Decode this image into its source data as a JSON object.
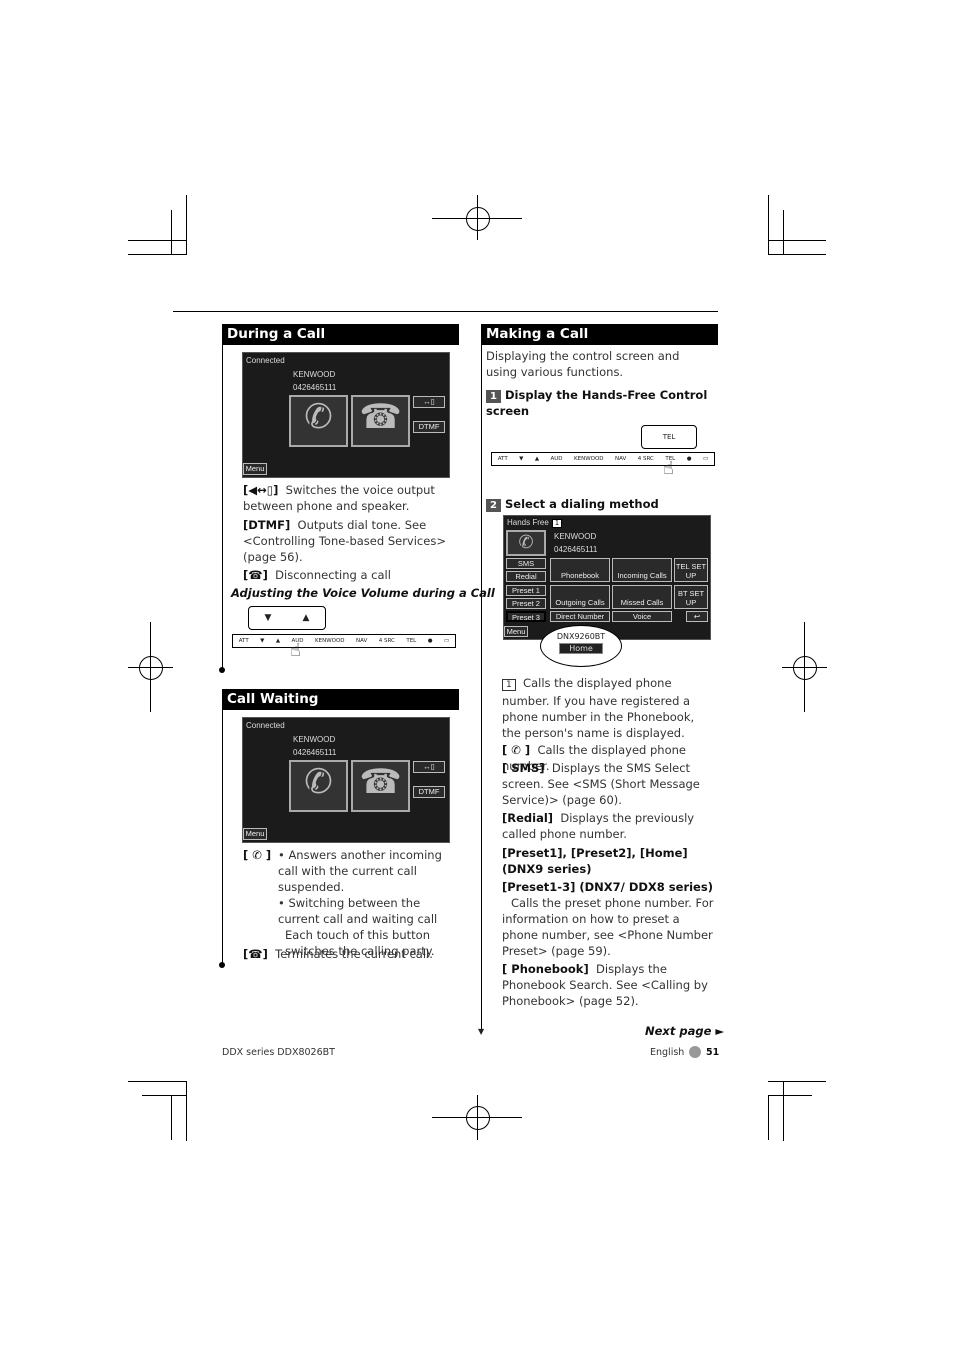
{
  "during_call": {
    "title": "During a Call",
    "screen": {
      "status": "Connected",
      "name": "KENWOOD",
      "number": "0426465111",
      "dtmf": "DTMF",
      "menu": "Menu"
    },
    "items": [
      {
        "key": "[◀↔▯]",
        "text": "Switches the voice output between phone and speaker."
      },
      {
        "key": "[DTMF]",
        "text": "Outputs dial tone.  See <Controlling Tone-based Services> (page 56)."
      },
      {
        "key": "[☎]",
        "text": "Disconnecting a call"
      }
    ],
    "subheading": "Adjusting the Voice Volume during a Call"
  },
  "control_bar": {
    "labels": [
      "ATT",
      "▼",
      "▲",
      "AUD",
      "KENWOOD",
      "NAV",
      "4 SRC",
      "TEL",
      "●",
      "▭"
    ],
    "popup_down": "▼",
    "popup_up": "▲",
    "tel_popup": "TEL"
  },
  "call_waiting": {
    "title": "Call Waiting",
    "screen": {
      "status": "Connected",
      "name": "KENWOOD",
      "number": "0426465111",
      "dtmf": "DTMF",
      "menu": "Menu"
    },
    "items": [
      {
        "key": "[ ✆ ]",
        "lines": [
          "• Answers another incoming call with the current call suspended.",
          "• Switching between the current call and waiting call",
          "Each touch of this button switches the calling party."
        ]
      },
      {
        "key": "[☎]",
        "text": "Terminates the current call."
      }
    ]
  },
  "making_call": {
    "title": "Making a Call",
    "intro": "Displaying the control screen and using various functions.",
    "step1": {
      "num": "1",
      "text": "Display the Hands-Free Control screen"
    },
    "step2": {
      "num": "2",
      "text": "Select a dialing method"
    },
    "screen": {
      "title": "Hands Free",
      "callout": "1",
      "name": "KENWOOD",
      "number": "0426465111",
      "left": [
        "SMS",
        "Redial",
        "Preset 1",
        "Preset 2",
        "Preset 3",
        "Menu"
      ],
      "grid": [
        "Phonebook",
        "Incoming Calls",
        "TEL SET UP",
        "Outgoing Calls",
        "Missed Calls",
        "BT SET UP",
        "Direct Number",
        "Voice"
      ],
      "model": "DNX9260BT",
      "home": "Home"
    },
    "items": [
      {
        "key": "1",
        "text": "Calls the displayed phone number. If you have registered a phone number in the Phonebook, the person's name is displayed."
      },
      {
        "key": "[ ✆ ]",
        "text": "Calls the displayed phone number."
      },
      {
        "key": "[ SMS]",
        "text": "Displays the SMS Select screen. See <SMS (Short Message Service)> (page 60)."
      },
      {
        "key": "[Redial]",
        "text": "Displays the previously called phone number."
      },
      {
        "key": "[Preset1], [Preset2], [Home] (DNX9 series)",
        "text": ""
      },
      {
        "key": "[Preset1-3] (DNX7/ DDX8 series)",
        "text": "Calls the preset phone number. For information on how to preset a phone number, see <Phone Number Preset> (page 59)."
      },
      {
        "key": "[ Phonebook]",
        "text": "Displays the Phonebook Search. See <Calling by Phonebook> (page 52)."
      }
    ],
    "next_page": "Next page ►"
  },
  "footer": {
    "left": "DDX series   DDX8026BT",
    "lang": "English",
    "page": "51"
  }
}
